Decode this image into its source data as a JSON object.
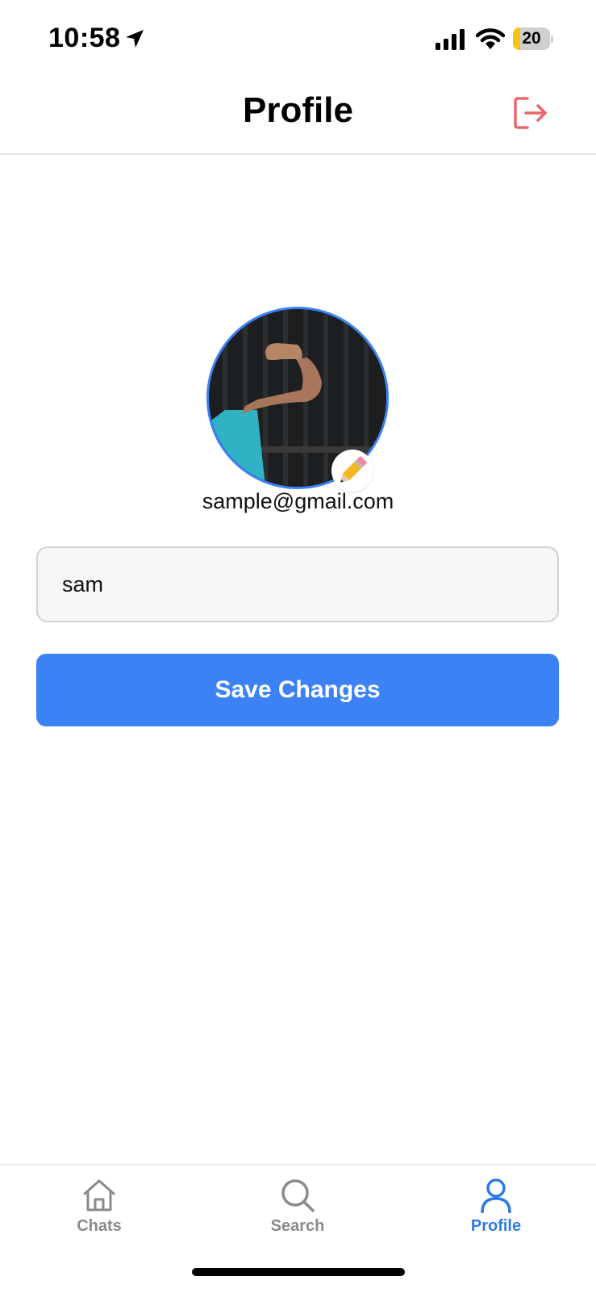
{
  "status_bar": {
    "time": "10:58",
    "battery_level": "20",
    "battery_fraction": 0.2,
    "icons": [
      "location-arrow-icon",
      "signal-icon",
      "wifi-icon",
      "battery-icon"
    ]
  },
  "header": {
    "title": "Profile",
    "logout_icon": "logout-icon",
    "logout_color": "#e8676b"
  },
  "profile": {
    "avatar": "profile-photo",
    "edit_icon": "pencil-icon",
    "email": "sample@gmail.com",
    "name_value": "sam",
    "accent_color": "#3b82f6"
  },
  "actions": {
    "save_label": "Save Changes"
  },
  "tab_bar": {
    "tabs": [
      {
        "label": "Chats",
        "icon": "home-icon",
        "active": false
      },
      {
        "label": "Search",
        "icon": "search-icon",
        "active": false
      },
      {
        "label": "Profile",
        "icon": "person-icon",
        "active": true
      }
    ],
    "active_color": "#2f7ae8",
    "inactive_color": "#8a8a8e"
  }
}
